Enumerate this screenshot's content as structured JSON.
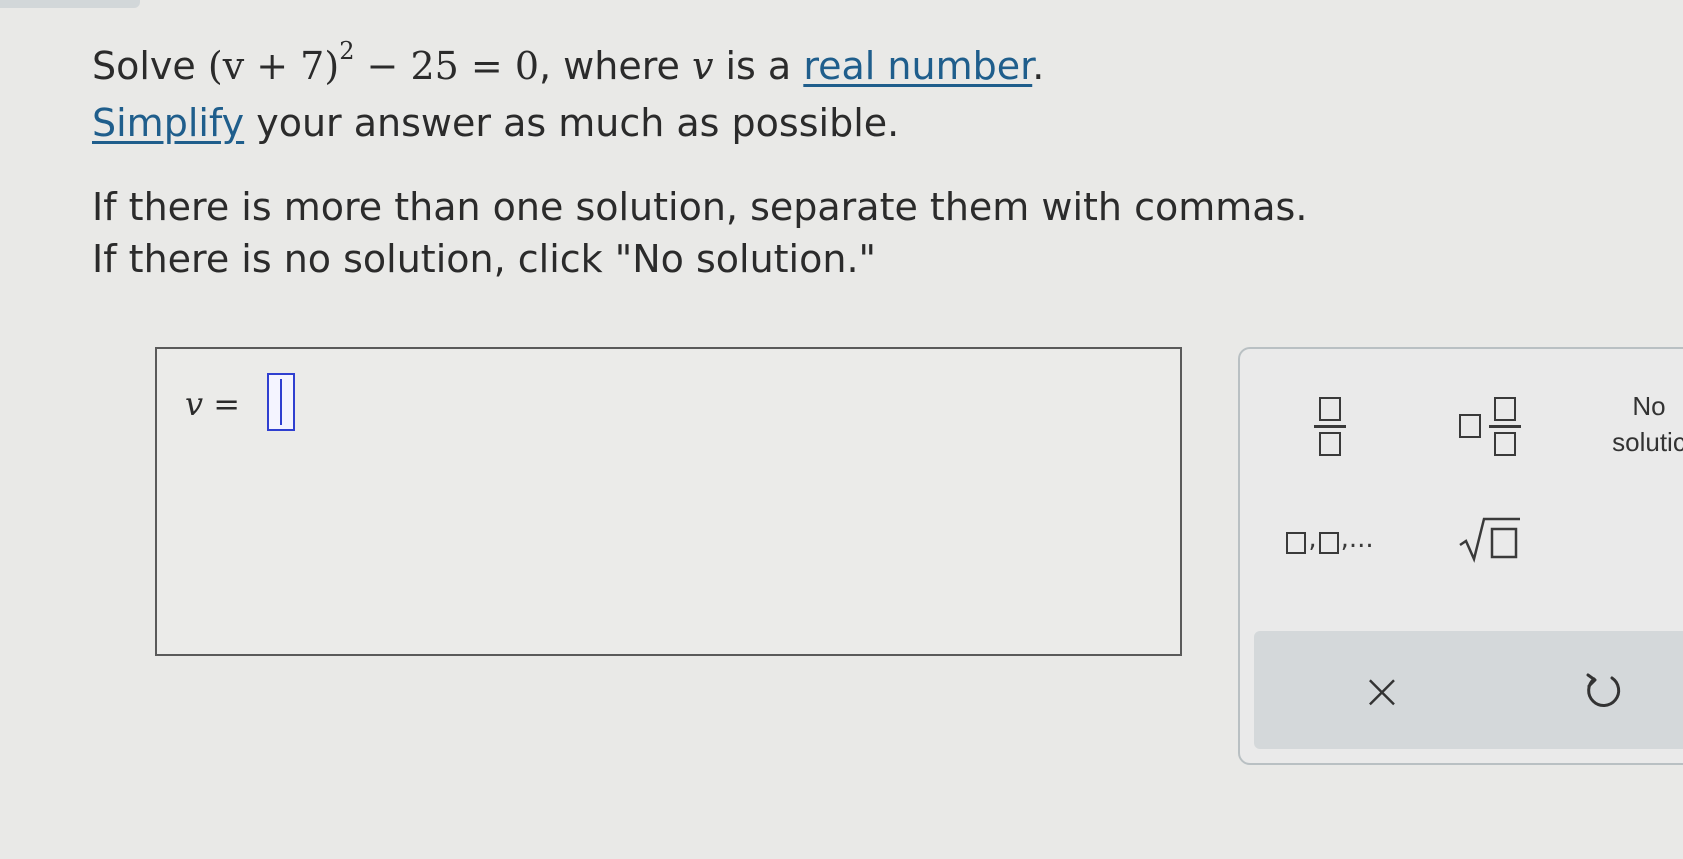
{
  "problem": {
    "solve_word": "Solve",
    "equation_base": "(v + 7)",
    "equation_exponent": "2",
    "equation_rest": " − 25 = 0",
    "where_text": ", where ",
    "variable": "v",
    "is_a_text": " is a ",
    "real_number_link": "real number",
    "period": ".",
    "simplify_link": "Simplify",
    "simplify_rest": " your answer as much as possible.",
    "instruction_1": "If there is more than one solution, separate them with commas.",
    "instruction_2": "If there is no solution, click \"No solution.\""
  },
  "answer": {
    "variable": "v",
    "equals": "=",
    "value": ""
  },
  "keypad": {
    "no_solution_line1": "No",
    "no_solution_line2": "solutic",
    "list_ellipsis": ",...",
    "list_comma": ",",
    "clear_symbol": "×"
  },
  "icons": [
    "fraction-icon",
    "mixed-number-icon",
    "list-icon",
    "sqrt-icon",
    "clear-icon",
    "undo-icon"
  ],
  "colors": {
    "link": "#1f5e8c",
    "input_border": "#2f3fd0",
    "background": "#e9e9e7",
    "keypad_bottom": "#d4d8da"
  }
}
